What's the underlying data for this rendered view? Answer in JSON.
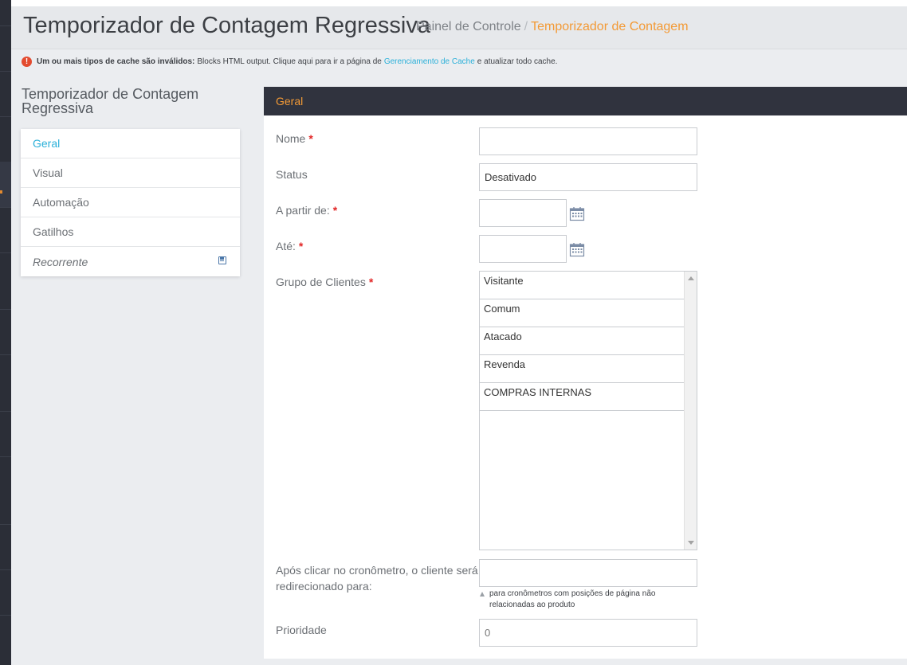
{
  "header": {
    "title": "Temporizador de Contagem Regressiva",
    "breadcrumb_home": "Painel de Controle",
    "breadcrumb_separator": "/",
    "breadcrumb_current": "Temporizador de Contagem"
  },
  "alert": {
    "icon": "exclamation-circle-icon",
    "bold": "Um ou mais tipos de cache são inválidos:",
    "text_before": "Blocks HTML output. Clique aqui para ir a página de",
    "link": "Gerenciamento de Cache",
    "text_after": "e atualizar todo cache."
  },
  "sidebar": {
    "title": "Temporizador de Contagem Regressiva",
    "tabs": [
      {
        "label": "Geral",
        "active": true
      },
      {
        "label": "Visual"
      },
      {
        "label": "Automação"
      },
      {
        "label": "Gatilhos"
      },
      {
        "label": "Recorrente",
        "icon": "save-icon"
      }
    ]
  },
  "form": {
    "section_title": "Geral",
    "name_label": "Nome",
    "name_value": "",
    "status_label": "Status",
    "status_value": "Desativado",
    "from_label": "A partir de:",
    "from_value": "",
    "to_label": "Até:",
    "to_value": "",
    "group_label": "Grupo de Clientes",
    "groups": [
      "Visitante",
      "Comum",
      "Atacado",
      "Revenda",
      "COMPRAS INTERNAS"
    ],
    "redirect_label": "Após clicar no cronômetro, o cliente será redirecionado para:",
    "redirect_value": "",
    "redirect_note": "para cronômetros com posições de página não relacionadas ao produto",
    "priority_label": "Prioridade",
    "priority_value": "0",
    "required_marker": "*"
  },
  "colors": {
    "accent": "#f39a36",
    "link": "#2bb0d9",
    "panel_header": "#30333e",
    "required": "#e22626"
  }
}
